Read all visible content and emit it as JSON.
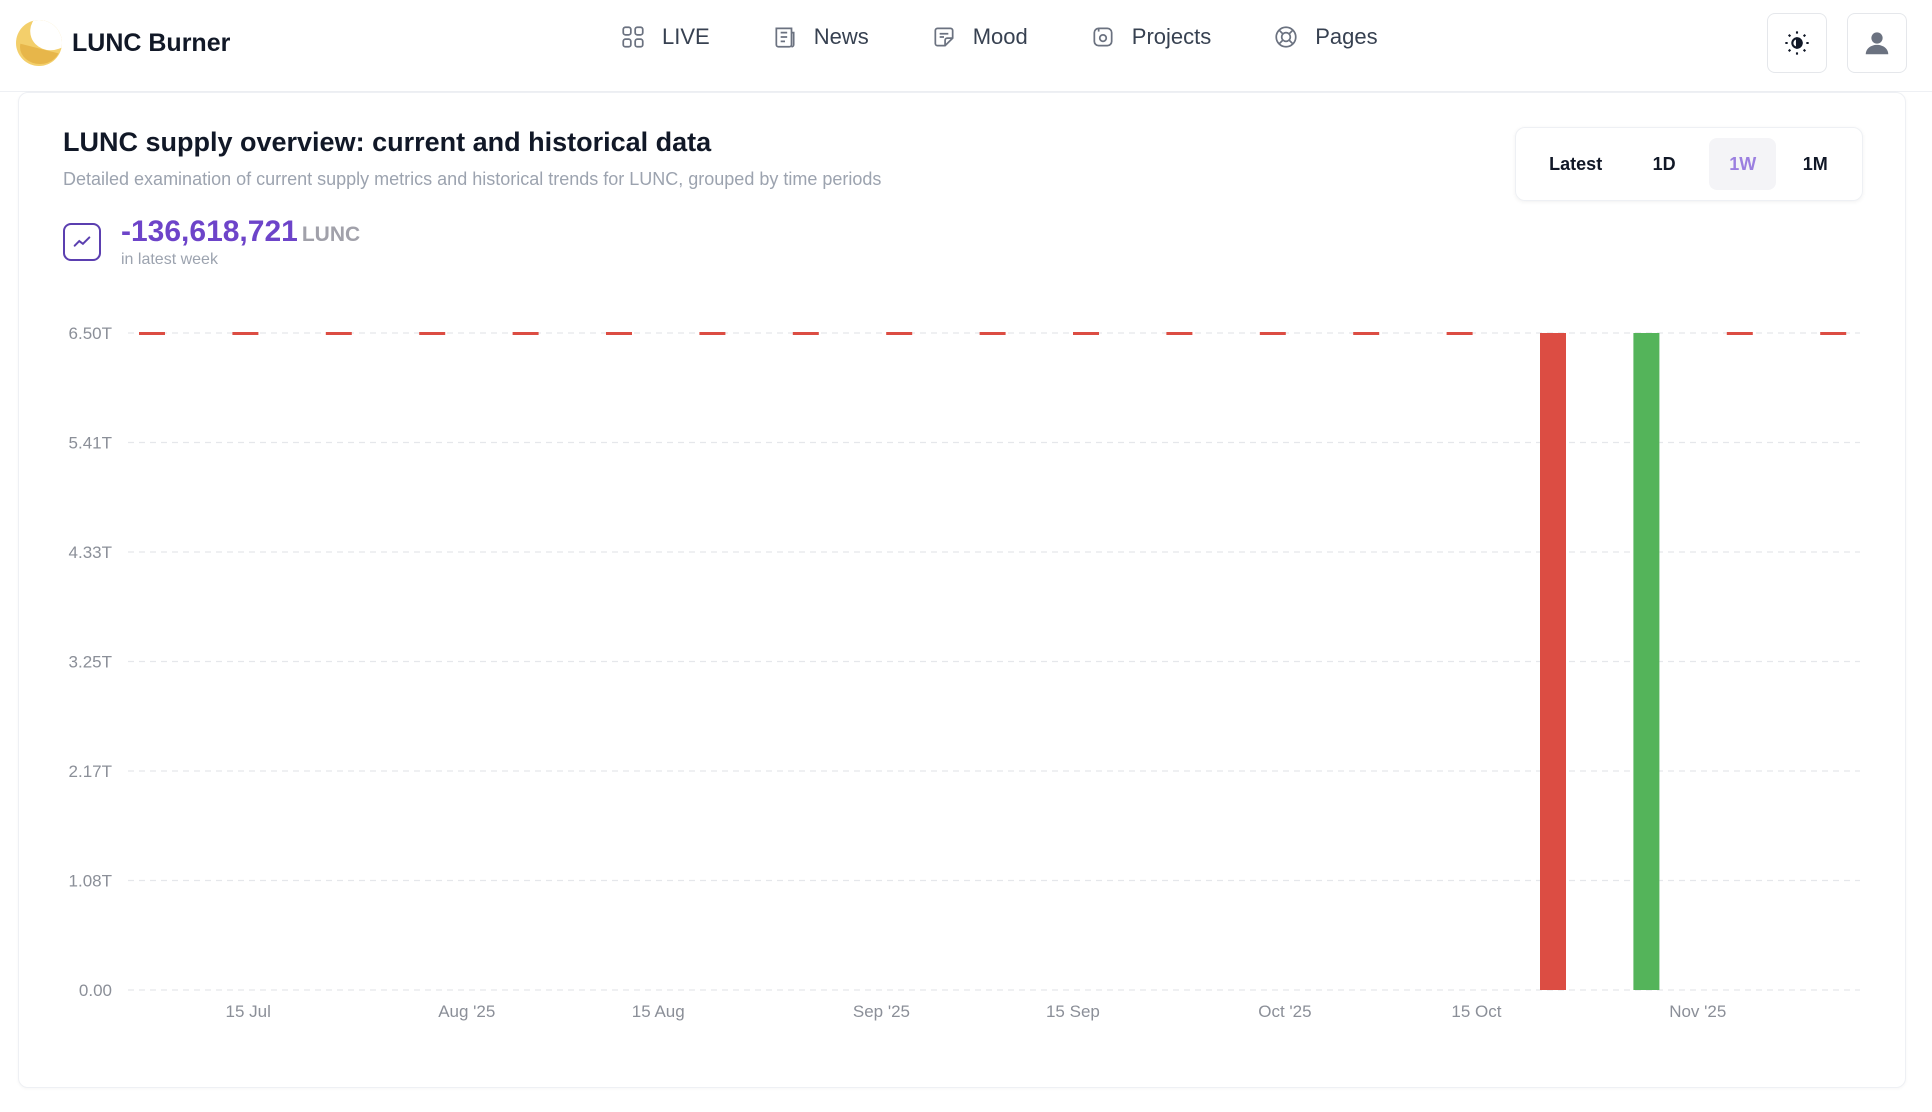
{
  "app": {
    "name": "LUNC Burner"
  },
  "nav": {
    "items": [
      {
        "label": "LIVE",
        "icon": "grid-icon"
      },
      {
        "label": "News",
        "icon": "newspaper-icon"
      },
      {
        "label": "Mood",
        "icon": "sticker-icon"
      },
      {
        "label": "Projects",
        "icon": "folder-icon"
      },
      {
        "label": "Pages",
        "icon": "lifebuoy-icon"
      }
    ]
  },
  "header": {
    "theme_icon": "sun-moon-icon",
    "user_icon": "user-icon"
  },
  "card": {
    "title": "LUNC supply overview: current and historical data",
    "subtitle": "Detailed examination of current supply metrics and historical trends for LUNC, grouped by time periods",
    "stat": {
      "value": "-136,618,721",
      "unit": "LUNC",
      "caption": "in latest week"
    },
    "periods": [
      {
        "label": "Latest",
        "active": false
      },
      {
        "label": "1D",
        "active": false
      },
      {
        "label": "1W",
        "active": true
      },
      {
        "label": "1M",
        "active": false
      }
    ]
  },
  "colors": {
    "accent": "#6d44c9",
    "burn": "#dc4d43",
    "mint": "#54b45a",
    "grid": "#e5e7eb"
  },
  "chart_data": {
    "type": "bar",
    "ylim": [
      0,
      6.5
    ],
    "y_unit": "T",
    "y_ticks": [
      "0.00",
      "1.08T",
      "2.17T",
      "3.25T",
      "4.33T",
      "5.41T",
      "6.50T"
    ],
    "x_ticks": [
      "15 Jul",
      "Aug '25",
      "15 Aug",
      "Sep '25",
      "15 Sep",
      "Oct '25",
      "15 Oct",
      "Nov '25"
    ],
    "x_tick_index": [
      1.03,
      3.37,
      5.42,
      7.81,
      9.86,
      12.13,
      14.18,
      16.55
    ],
    "series": [
      {
        "values": [
          6.5,
          6.5,
          6.5,
          6.5,
          6.5,
          6.5,
          6.5,
          6.5,
          6.5,
          6.5,
          6.5,
          6.5,
          6.5,
          6.5,
          6.5,
          6.5,
          6.5,
          6.5,
          6.5
        ],
        "kind": [
          "cap",
          "cap",
          "cap",
          "cap",
          "cap",
          "cap",
          "cap",
          "cap",
          "cap",
          "cap",
          "cap",
          "cap",
          "cap",
          "cap",
          "cap",
          "full",
          "full",
          "cap",
          "cap"
        ],
        "bar_color": [
          "burn",
          "burn",
          "burn",
          "burn",
          "burn",
          "burn",
          "burn",
          "burn",
          "burn",
          "burn",
          "burn",
          "burn",
          "burn",
          "burn",
          "burn",
          "burn",
          "mint",
          "burn",
          "burn"
        ]
      }
    ]
  }
}
